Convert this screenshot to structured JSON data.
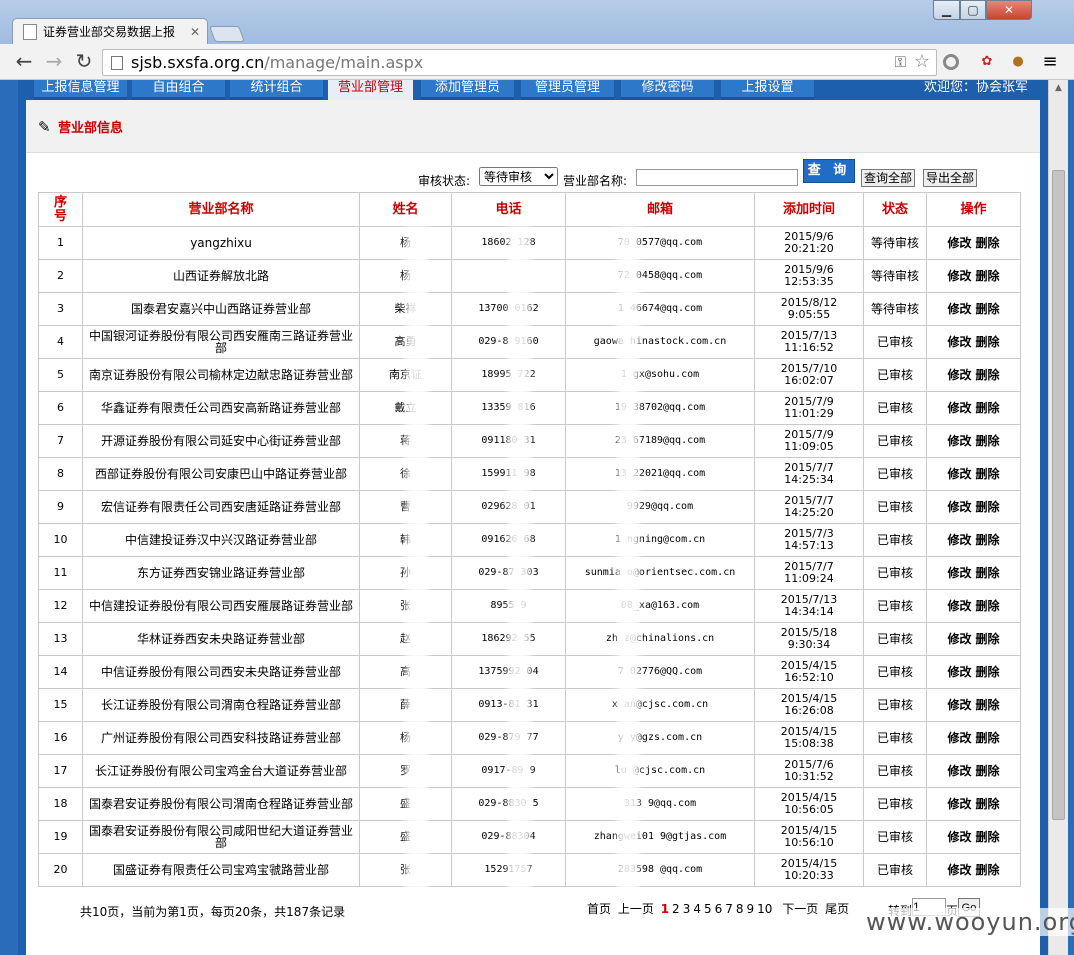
{
  "browser": {
    "tab_title": "证券营业部交易数据上报",
    "url_host": "sjsb.sxsfa.org.cn",
    "url_path": "/manage/main.aspx"
  },
  "nav": {
    "items": [
      "上报信息管理",
      "自由组合",
      "统计组合",
      "营业部管理",
      "添加管理员",
      "管理员管理",
      "修改密码",
      "上报设置"
    ],
    "active": "营业部管理",
    "welcome": "欢迎您：协会张军"
  },
  "section": {
    "title": "营业部信息"
  },
  "filters": {
    "status_label": "审核状态:",
    "status_value": "等待审核",
    "name_label": "营业部名称:",
    "name_value": "",
    "query_button": "查 询",
    "query_all_button": "查询全部",
    "export_all_button": "导出全部"
  },
  "table": {
    "headers": [
      "序号",
      "营业部名称",
      "姓名",
      "电话",
      "邮箱",
      "添加时间",
      "状态",
      "操作"
    ],
    "edit_label": "修改",
    "delete_label": "删除",
    "rows": [
      {
        "no": "1",
        "name": "yangzhixu",
        "person": "杨",
        "phone": "18602 128",
        "email": "70 0577@qq.com",
        "date": "2015/9/6",
        "time": "20:21:20",
        "status": "等待审核"
      },
      {
        "no": "2",
        "name": "山西证券解放北路",
        "person": "杨",
        "phone": "",
        "email": "72 0458@qq.com",
        "date": "2015/9/6",
        "time": "12:53:35",
        "status": "等待审核"
      },
      {
        "no": "3",
        "name": "国泰君安嘉兴中山西路证券营业部",
        "person": "柴祥",
        "phone": "13700 0162",
        "email": "1 46674@qq.com",
        "date": "2015/8/12",
        "time": "9:05:55",
        "status": "等待审核"
      },
      {
        "no": "4",
        "name": "中国银河证券股份有限公司西安雁南三路证券营业部",
        "person": "高勇",
        "phone": "029-8 9160",
        "email": "gaowa hinastock.com.cn",
        "date": "2015/7/13",
        "time": "11:16:52",
        "status": "已审核"
      },
      {
        "no": "5",
        "name": "南京证券股份有限公司榆林定边献忠路证券营业部",
        "person": "南京证",
        "phone": "18995 722",
        "email": "1 gx@sohu.com",
        "date": "2015/7/10",
        "time": "16:02:07",
        "status": "已审核"
      },
      {
        "no": "6",
        "name": "华鑫证券有限责任公司西安高新路证券营业部",
        "person": "戴立",
        "phone": "13359 816",
        "email": "19 38702@qq.com",
        "date": "2015/7/9",
        "time": "11:01:29",
        "status": "已审核"
      },
      {
        "no": "7",
        "name": "开源证券股份有限公司延安中心街证券营业部",
        "person": "蒋",
        "phone": "091180 31",
        "email": "23 67189@qq.com",
        "date": "2015/7/9",
        "time": "11:09:05",
        "status": "已审核"
      },
      {
        "no": "8",
        "name": "西部证券股份有限公司安康巴山中路证券营业部",
        "person": "徐",
        "phone": "159911 98",
        "email": "13 22021@qq.com",
        "date": "2015/7/7",
        "time": "14:25:34",
        "status": "已审核"
      },
      {
        "no": "9",
        "name": "宏信证券有限责任公司西安唐延路证券营业部",
        "person": "曹",
        "phone": "029628 01",
        "email": "9929@qq.com",
        "date": "2015/7/7",
        "time": "14:25:20",
        "status": "已审核"
      },
      {
        "no": "10",
        "name": "中信建投证券汉中兴汉路证券营业部",
        "person": "韩",
        "phone": "091626 68",
        "email": "1 ngning@com.cn",
        "date": "2015/7/3",
        "time": "14:57:13",
        "status": "已审核"
      },
      {
        "no": "11",
        "name": "东方证券西安锦业路证券营业部",
        "person": "孙",
        "phone": "029-87 303",
        "email": "sunmia o@orientsec.com.cn",
        "date": "2015/7/7",
        "time": "11:09:24",
        "status": "已审核"
      },
      {
        "no": "12",
        "name": "中信建投证券股份有限公司西安雁展路证券营业部",
        "person": "张",
        "phone": "8955 9",
        "email": "08_xa@163.com",
        "date": "2015/7/13",
        "time": "14:34:14",
        "status": "已审核"
      },
      {
        "no": "13",
        "name": "华林证券西安未央路证券营业部",
        "person": "赵",
        "phone": "186292 55",
        "email": "zh z@chinalions.cn",
        "date": "2015/5/18",
        "time": "9:30:34",
        "status": "已审核"
      },
      {
        "no": "14",
        "name": "中信证券股份有限公司西安未央路证券营业部",
        "person": "高",
        "phone": "1375992 04",
        "email": "7 02776@QQ.com",
        "date": "2015/4/15",
        "time": "16:52:10",
        "status": "已审核"
      },
      {
        "no": "15",
        "name": "长江证券股份有限公司渭南仓程路证券营业部",
        "person": "薛",
        "phone": "0913-81 31",
        "email": "x an@cjsc.com.cn",
        "date": "2015/4/15",
        "time": "16:26:08",
        "status": "已审核"
      },
      {
        "no": "16",
        "name": "广州证券股份有限公司西安科技路证券营业部",
        "person": "杨",
        "phone": "029-879 77",
        "email": "y y@gzs.com.cn",
        "date": "2015/4/15",
        "time": "15:08:38",
        "status": "已审核"
      },
      {
        "no": "17",
        "name": "长江证券股份有限公司宝鸡金台大道证券营业部",
        "person": "罗",
        "phone": "0917-89 9",
        "email": "lu @cjsc.com.cn",
        "date": "2015/7/6",
        "time": "10:31:52",
        "status": "已审核"
      },
      {
        "no": "18",
        "name": "国泰君安证券股份有限公司渭南仓程路证券营业部",
        "person": "盛",
        "phone": "029-8830 5",
        "email": "313 9@qq.com",
        "date": "2015/4/15",
        "time": "10:56:05",
        "status": "已审核"
      },
      {
        "no": "19",
        "name": "国泰君安证券股份有限公司咸阳世纪大道证券营业部",
        "person": "盛",
        "phone": "029-88304",
        "email": "zhangwei01 9@gtjas.com",
        "date": "2015/4/15",
        "time": "10:56:10",
        "status": "已审核"
      },
      {
        "no": "20",
        "name": "国盛证券有限责任公司宝鸡宝虢路营业部",
        "person": "张",
        "phone": "15291757",
        "email": "283598 @qq.com",
        "date": "2015/4/15",
        "time": "10:20:33",
        "status": "已审核"
      }
    ]
  },
  "footer": {
    "summary": "共10页，当前为第1页，每页20条，共187条记录",
    "first": "首页",
    "prev": "上一页",
    "pages": [
      "1",
      "2",
      "3",
      "4",
      "5",
      "6",
      "7",
      "8",
      "9",
      "10"
    ],
    "current_page": "1",
    "next": "下一页",
    "last": "尾页",
    "goto_label": "转到",
    "goto_value": "1",
    "goto_unit": "页",
    "go_button": "Go"
  },
  "watermark": "www.wooyun.org"
}
